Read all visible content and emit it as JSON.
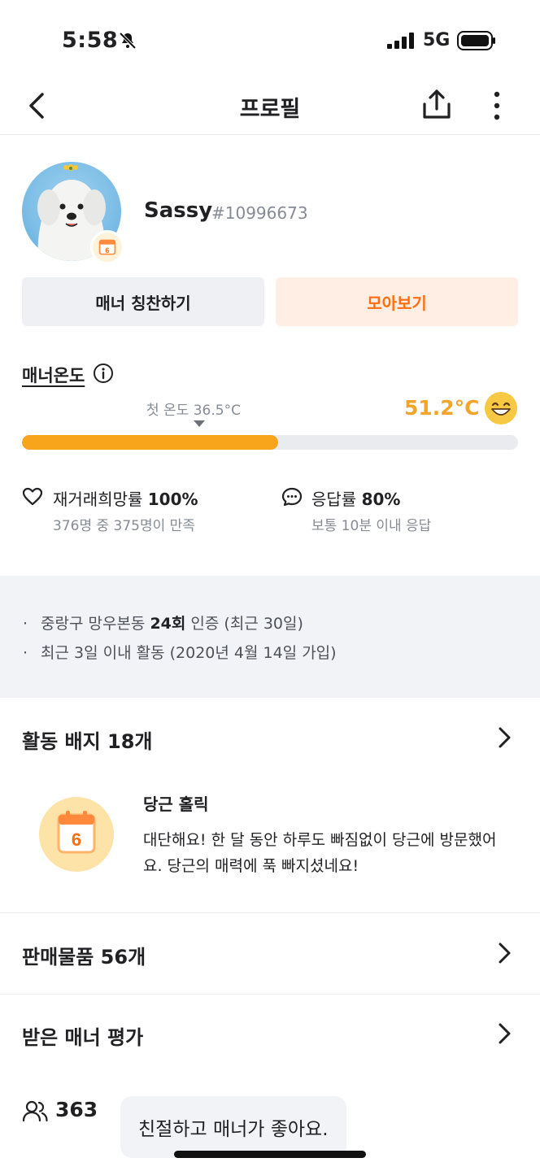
{
  "status_bar": {
    "time": "5:58",
    "network": "5G"
  },
  "nav": {
    "title": "프로필"
  },
  "profile": {
    "name": "Sassy",
    "id": "#10996673"
  },
  "buttons": {
    "praise": "매너 칭찬하기",
    "collect": "모아보기"
  },
  "manner": {
    "title": "매너온도",
    "first_temp": "첫 온도 36.5°C",
    "value": "51.2°C",
    "fill_fraction": 0.517
  },
  "stats": {
    "rehire_label": "재거래희망률",
    "rehire_value": "100%",
    "rehire_sub": "376명 중 375명이 만족",
    "response_label": "응답률",
    "response_value": "80%",
    "response_sub": "보통 10분 이내 응답"
  },
  "info": {
    "line1_pre": "중랑구 망우본동 ",
    "line1_bold": "24회",
    "line1_post": " 인증 (최근 30일)",
    "line2": "최근 3일 이내 활동 (2020년 4월 14일 가입)"
  },
  "sections": {
    "badges_title": "활동 배지 18개",
    "sales_title": "판매물품 56개",
    "reviews_title": "받은 매너 평가"
  },
  "badge": {
    "title": "당근 홀릭",
    "desc": "대단해요! 한 달 동안 하루도 빠짐없이 당근에 방문했어요. 당근의 매력에 푹 빠지셨네요!"
  },
  "review": {
    "count": "363",
    "text": "친절하고 매너가 좋아요."
  },
  "colors": {
    "accent": "#ff6f0f",
    "temp": "#f2a52a",
    "bar": "#f8a51b"
  }
}
